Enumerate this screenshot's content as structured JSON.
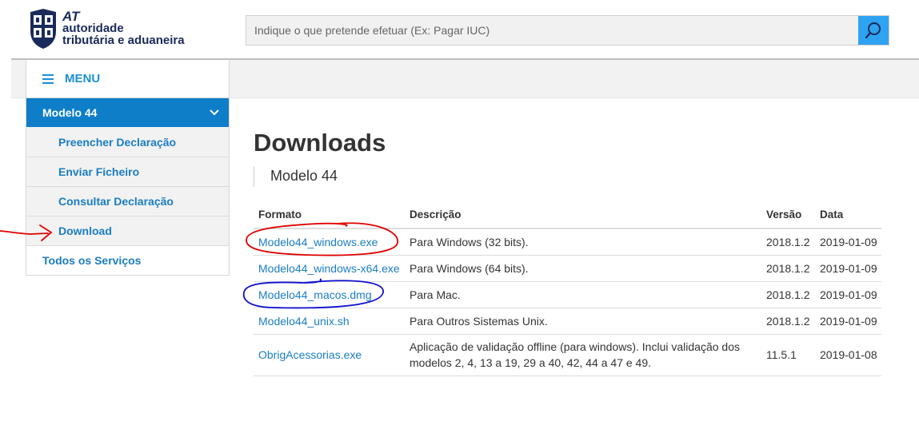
{
  "header": {
    "logo": {
      "at": "AT",
      "line1": "autoridade",
      "line2": "tributária e aduaneira"
    },
    "search": {
      "placeholder": "Indique o que pretende efetuar (Ex: Pagar IUC)",
      "value": ""
    }
  },
  "menu": {
    "label": "MENU"
  },
  "sidebar": {
    "active": "Modelo 44",
    "sub_items": [
      "Preencher Declaração",
      "Enviar Ficheiro",
      "Consultar Declaração",
      "Download"
    ],
    "all_services": "Todos os Serviços"
  },
  "main": {
    "title": "Downloads",
    "subtitle": "Modelo 44",
    "table": {
      "headers": [
        "Formato",
        "Descrição",
        "Versão",
        "Data"
      ],
      "rows": [
        {
          "file": "Modelo44_windows.exe",
          "desc": "Para Windows (32 bits).",
          "version": "2018.1.2",
          "date": "2019-01-09"
        },
        {
          "file": "Modelo44_windows-x64.exe",
          "desc": "Para Windows (64 bits).",
          "version": "2018.1.2",
          "date": "2019-01-09"
        },
        {
          "file": "Modelo44_macos.dmg",
          "desc": "Para Mac.",
          "version": "2018.1.2",
          "date": "2019-01-09"
        },
        {
          "file": "Modelo44_unix.sh",
          "desc": "Para Outros Sistemas Unix.",
          "version": "2018.1.2",
          "date": "2019-01-09"
        },
        {
          "file": "ObrigAcessorias.exe",
          "desc": "Aplicação de validação offline (para windows). Inclui validação dos modelos 2, 4, 13 a 19, 29 a 40, 42, 44 a 47 e 49.",
          "version": "11.5.1",
          "date": "2019-01-08"
        }
      ]
    }
  },
  "colors": {
    "accent": "#0f7ec9",
    "link": "#1a7dc4",
    "search_button": "#2ea3f2",
    "annotation_red": "#e00000",
    "annotation_blue": "#1010d0"
  }
}
